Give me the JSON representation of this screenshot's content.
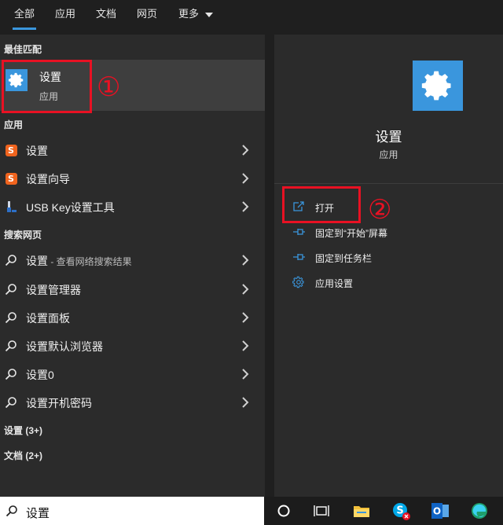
{
  "tabs": [
    {
      "label": "全部"
    },
    {
      "label": "应用"
    },
    {
      "label": "文档"
    },
    {
      "label": "网页"
    },
    {
      "label": "更多"
    }
  ],
  "best_match": {
    "heading": "最佳匹配",
    "title": "设置",
    "subtitle": "应用",
    "annotation": "①"
  },
  "apps": {
    "heading": "应用",
    "items": [
      {
        "label": "设置",
        "icon": "sogou-icon"
      },
      {
        "label": "设置向导",
        "icon": "sogou-icon"
      },
      {
        "label": "USB Key设置工具",
        "icon": "usb-key-icon"
      }
    ]
  },
  "web": {
    "heading": "搜索网页",
    "items": [
      {
        "label": "设置",
        "sub": " - 查看网络搜索结果"
      },
      {
        "label": "设置管理器",
        "sub": ""
      },
      {
        "label": "设置面板",
        "sub": ""
      },
      {
        "label": "设置默认浏览器",
        "sub": ""
      },
      {
        "label": "设置0",
        "sub": ""
      },
      {
        "label": "设置开机密码",
        "sub": ""
      }
    ]
  },
  "more_sections": [
    {
      "label": "设置 (3+)"
    },
    {
      "label": "文档 (2+)"
    }
  ],
  "detail": {
    "title": "设置",
    "subtitle": "应用",
    "annotation": "②",
    "actions": [
      {
        "label": "打开",
        "icon": "open-icon"
      },
      {
        "label": "固定到“开始”屏幕",
        "icon": "pin-icon"
      },
      {
        "label": "固定到任务栏",
        "icon": "pin-icon"
      },
      {
        "label": "应用设置",
        "icon": "gear-icon"
      }
    ]
  },
  "search": {
    "value": "设置"
  },
  "taskbar": [
    {
      "name": "cortana-icon"
    },
    {
      "name": "task-view-icon"
    },
    {
      "name": "file-explorer-icon"
    },
    {
      "name": "skype-icon"
    },
    {
      "name": "outlook-icon"
    },
    {
      "name": "edge-icon"
    }
  ],
  "colors": {
    "accent": "#3a96dd",
    "annotation": "#e81123",
    "sogou": "#f0641e"
  }
}
